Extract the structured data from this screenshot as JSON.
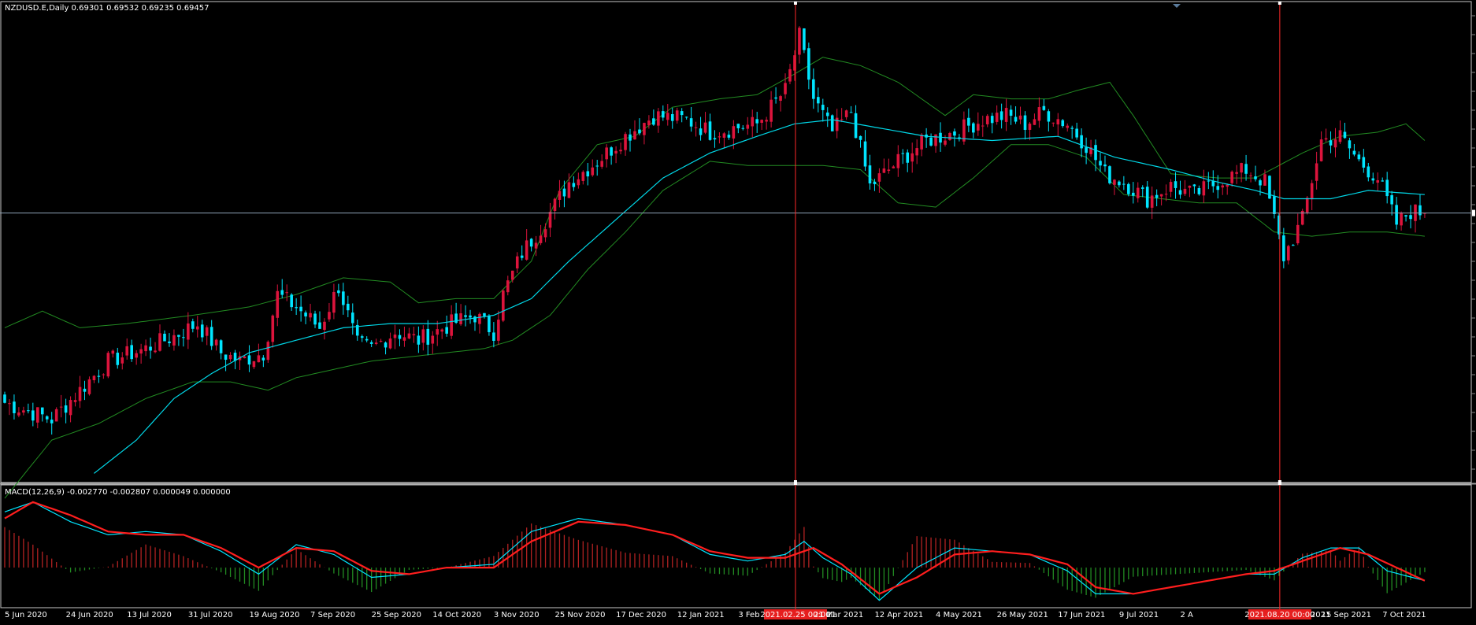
{
  "header": {
    "symbol_line": "NZDUSD.E,Daily  0.69301 0.69532 0.69235 0.69457",
    "macd_line": "MACD(12,26,9) -0.002770 -0.002807 0.000049 0.000000"
  },
  "colors": {
    "background": "#000000",
    "bull_candle": "#dc143c",
    "bear_candle": "#00e5ff",
    "ma_line": "#00d8e8",
    "bands": "#228b22",
    "macd_hist_pos": "#b22222",
    "macd_hist_neg": "#228b22",
    "macd_signal": "#ff1e1e",
    "macd_main": "#00e5ff",
    "vline": "#ff2a2a",
    "hline": "#8fa4b8"
  },
  "chart_data": {
    "type": "candlestick",
    "symbol": "NZDUSD.E",
    "timeframe": "Daily",
    "price_range": [
      0.63,
      0.745
    ],
    "x_tick_labels": [
      "5 Jun 2020",
      "24 Jun 2020",
      "13 Jul 2020",
      "31 Jul 2020",
      "19 Aug 2020",
      "7 Sep 2020",
      "25 Sep 2020",
      "14 Oct 2020",
      "3 Nov 2020",
      "25 Nov 2020",
      "17 Dec 2020",
      "12 Jan 2021",
      "3 Feb",
      "21 Mar 2021",
      "12 Apr 2021",
      "4 May 2021",
      "26 May 2021",
      "17 Jun 2021",
      "9 Jul 2021",
      "2 A",
      "15 Sep 2021",
      "7 Oct 2021"
    ],
    "x_tick_bars": [
      0,
      13,
      26,
      39,
      52,
      65,
      78,
      91,
      104,
      117,
      130,
      143,
      156,
      172,
      185,
      198,
      211,
      224,
      237,
      250,
      280,
      293
    ],
    "x_tick_labels_tail": [
      "21",
      "2021"
    ],
    "marker_labels": [
      {
        "bar": 168,
        "label": "2021.02.25 00:00"
      },
      {
        "bar": 271,
        "label": "2021.08.20 00:00"
      }
    ],
    "current_price": 0.69457,
    "close_path": [
      [
        0,
        0.649
      ],
      [
        10,
        0.645
      ],
      [
        16,
        0.652
      ],
      [
        22,
        0.659
      ],
      [
        30,
        0.662
      ],
      [
        36,
        0.665
      ],
      [
        41,
        0.668
      ],
      [
        46,
        0.661
      ],
      [
        50,
        0.659
      ],
      [
        55,
        0.661
      ],
      [
        58,
        0.675
      ],
      [
        62,
        0.672
      ],
      [
        67,
        0.667
      ],
      [
        71,
        0.677
      ],
      [
        75,
        0.663
      ],
      [
        78,
        0.662
      ],
      [
        83,
        0.666
      ],
      [
        88,
        0.664
      ],
      [
        95,
        0.668
      ],
      [
        100,
        0.67
      ],
      [
        104,
        0.666
      ],
      [
        106,
        0.675
      ],
      [
        110,
        0.685
      ],
      [
        114,
        0.691
      ],
      [
        120,
        0.702
      ],
      [
        126,
        0.707
      ],
      [
        132,
        0.713
      ],
      [
        138,
        0.718
      ],
      [
        145,
        0.717
      ],
      [
        150,
        0.714
      ],
      [
        155,
        0.715
      ],
      [
        160,
        0.716
      ],
      [
        166,
        0.724
      ],
      [
        169,
        0.737
      ],
      [
        172,
        0.722
      ],
      [
        176,
        0.714
      ],
      [
        180,
        0.719
      ],
      [
        184,
        0.701
      ],
      [
        190,
        0.707
      ],
      [
        196,
        0.712
      ],
      [
        202,
        0.714
      ],
      [
        208,
        0.717
      ],
      [
        213,
        0.718
      ],
      [
        217,
        0.716
      ],
      [
        221,
        0.719
      ],
      [
        226,
        0.716
      ],
      [
        230,
        0.711
      ],
      [
        234,
        0.704
      ],
      [
        238,
        0.702
      ],
      [
        243,
        0.698
      ],
      [
        248,
        0.701
      ],
      [
        253,
        0.699
      ],
      [
        258,
        0.702
      ],
      [
        264,
        0.705
      ],
      [
        268,
        0.702
      ],
      [
        272,
        0.684
      ],
      [
        276,
        0.693
      ],
      [
        280,
        0.712
      ],
      [
        284,
        0.713
      ],
      [
        288,
        0.707
      ],
      [
        292,
        0.703
      ],
      [
        296,
        0.692
      ],
      [
        299,
        0.695
      ],
      [
        302,
        0.6946
      ]
    ],
    "ma_path": [
      [
        19,
        0.632
      ],
      [
        28,
        0.64
      ],
      [
        36,
        0.65
      ],
      [
        44,
        0.656
      ],
      [
        52,
        0.661
      ],
      [
        62,
        0.664
      ],
      [
        72,
        0.667
      ],
      [
        82,
        0.668
      ],
      [
        92,
        0.668
      ],
      [
        104,
        0.67
      ],
      [
        112,
        0.674
      ],
      [
        120,
        0.683
      ],
      [
        130,
        0.693
      ],
      [
        140,
        0.703
      ],
      [
        150,
        0.709
      ],
      [
        160,
        0.713
      ],
      [
        168,
        0.716
      ],
      [
        176,
        0.717
      ],
      [
        186,
        0.715
      ],
      [
        196,
        0.713
      ],
      [
        210,
        0.712
      ],
      [
        224,
        0.713
      ],
      [
        236,
        0.708
      ],
      [
        248,
        0.705
      ],
      [
        258,
        0.702
      ],
      [
        266,
        0.7
      ],
      [
        272,
        0.698
      ],
      [
        282,
        0.698
      ],
      [
        290,
        0.7
      ],
      [
        302,
        0.699
      ]
    ],
    "upper_band_path": [
      [
        0,
        0.667
      ],
      [
        8,
        0.671
      ],
      [
        16,
        0.667
      ],
      [
        26,
        0.668
      ],
      [
        40,
        0.67
      ],
      [
        52,
        0.672
      ],
      [
        62,
        0.675
      ],
      [
        72,
        0.679
      ],
      [
        82,
        0.678
      ],
      [
        88,
        0.673
      ],
      [
        96,
        0.674
      ],
      [
        104,
        0.674
      ],
      [
        112,
        0.683
      ],
      [
        118,
        0.7
      ],
      [
        126,
        0.711
      ],
      [
        134,
        0.713
      ],
      [
        142,
        0.72
      ],
      [
        152,
        0.722
      ],
      [
        160,
        0.723
      ],
      [
        168,
        0.728
      ],
      [
        174,
        0.732
      ],
      [
        182,
        0.73
      ],
      [
        190,
        0.726
      ],
      [
        200,
        0.718
      ],
      [
        206,
        0.723
      ],
      [
        214,
        0.722
      ],
      [
        222,
        0.722
      ],
      [
        228,
        0.724
      ],
      [
        235,
        0.726
      ],
      [
        240,
        0.718
      ],
      [
        248,
        0.704
      ],
      [
        258,
        0.703
      ],
      [
        266,
        0.703
      ],
      [
        276,
        0.709
      ],
      [
        284,
        0.713
      ],
      [
        292,
        0.714
      ],
      [
        298,
        0.716
      ],
      [
        302,
        0.712
      ]
    ],
    "lower_band_path": [
      [
        0,
        0.626
      ],
      [
        10,
        0.64
      ],
      [
        20,
        0.644
      ],
      [
        30,
        0.65
      ],
      [
        40,
        0.654
      ],
      [
        48,
        0.654
      ],
      [
        56,
        0.652
      ],
      [
        62,
        0.655
      ],
      [
        70,
        0.657
      ],
      [
        78,
        0.659
      ],
      [
        86,
        0.66
      ],
      [
        94,
        0.661
      ],
      [
        102,
        0.662
      ],
      [
        108,
        0.664
      ],
      [
        116,
        0.67
      ],
      [
        124,
        0.681
      ],
      [
        132,
        0.69
      ],
      [
        140,
        0.7
      ],
      [
        150,
        0.707
      ],
      [
        158,
        0.706
      ],
      [
        166,
        0.706
      ],
      [
        174,
        0.706
      ],
      [
        182,
        0.705
      ],
      [
        190,
        0.697
      ],
      [
        198,
        0.696
      ],
      [
        206,
        0.703
      ],
      [
        214,
        0.711
      ],
      [
        222,
        0.711
      ],
      [
        230,
        0.708
      ],
      [
        238,
        0.699
      ],
      [
        246,
        0.698
      ],
      [
        254,
        0.697
      ],
      [
        262,
        0.697
      ],
      [
        270,
        0.69
      ],
      [
        278,
        0.689
      ],
      [
        286,
        0.69
      ],
      [
        294,
        0.69
      ],
      [
        302,
        0.689
      ]
    ],
    "macd": {
      "range": [
        -0.012,
        0.025
      ],
      "main_path": [
        [
          0,
          0.017
        ],
        [
          6,
          0.02
        ],
        [
          14,
          0.014
        ],
        [
          22,
          0.01
        ],
        [
          30,
          0.011
        ],
        [
          38,
          0.01
        ],
        [
          46,
          0.005
        ],
        [
          54,
          -0.002
        ],
        [
          62,
          0.007
        ],
        [
          70,
          0.004
        ],
        [
          78,
          -0.003
        ],
        [
          86,
          -0.002
        ],
        [
          94,
          0.0
        ],
        [
          104,
          0.001
        ],
        [
          112,
          0.011
        ],
        [
          122,
          0.015
        ],
        [
          132,
          0.013
        ],
        [
          142,
          0.01
        ],
        [
          150,
          0.004
        ],
        [
          158,
          0.002
        ],
        [
          166,
          0.004
        ],
        [
          170,
          0.008
        ],
        [
          174,
          0.003
        ],
        [
          180,
          -0.002
        ],
        [
          186,
          -0.01
        ],
        [
          194,
          0.0
        ],
        [
          202,
          0.006
        ],
        [
          210,
          0.005
        ],
        [
          218,
          0.004
        ],
        [
          226,
          -0.001
        ],
        [
          232,
          -0.008
        ],
        [
          240,
          -0.008
        ],
        [
          248,
          -0.006
        ],
        [
          256,
          -0.004
        ],
        [
          264,
          -0.002
        ],
        [
          270,
          -0.002
        ],
        [
          276,
          0.003
        ],
        [
          282,
          0.006
        ],
        [
          288,
          0.006
        ],
        [
          294,
          -0.001
        ],
        [
          302,
          -0.004
        ]
      ],
      "signal_path": [
        [
          0,
          0.015
        ],
        [
          6,
          0.02
        ],
        [
          14,
          0.016
        ],
        [
          22,
          0.011
        ],
        [
          30,
          0.01
        ],
        [
          38,
          0.01
        ],
        [
          46,
          0.006
        ],
        [
          54,
          0.0
        ],
        [
          62,
          0.006
        ],
        [
          70,
          0.005
        ],
        [
          78,
          -0.001
        ],
        [
          86,
          -0.002
        ],
        [
          94,
          0.0
        ],
        [
          104,
          0.0
        ],
        [
          112,
          0.008
        ],
        [
          122,
          0.014
        ],
        [
          132,
          0.013
        ],
        [
          142,
          0.01
        ],
        [
          150,
          0.005
        ],
        [
          158,
          0.003
        ],
        [
          166,
          0.003
        ],
        [
          172,
          0.006
        ],
        [
          178,
          0.001
        ],
        [
          186,
          -0.008
        ],
        [
          194,
          -0.003
        ],
        [
          202,
          0.004
        ],
        [
          210,
          0.005
        ],
        [
          218,
          0.004
        ],
        [
          226,
          0.001
        ],
        [
          232,
          -0.006
        ],
        [
          240,
          -0.008
        ],
        [
          248,
          -0.006
        ],
        [
          256,
          -0.004
        ],
        [
          264,
          -0.002
        ],
        [
          270,
          -0.001
        ],
        [
          278,
          0.003
        ],
        [
          284,
          0.006
        ],
        [
          290,
          0.004
        ],
        [
          296,
          0.0
        ],
        [
          302,
          -0.004
        ]
      ]
    }
  }
}
